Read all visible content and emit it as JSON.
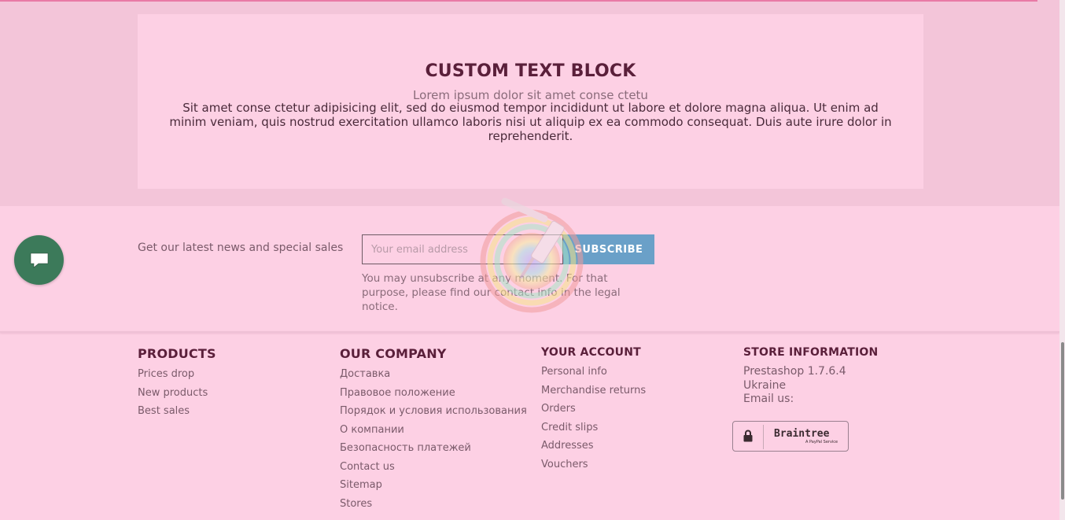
{
  "custom_block": {
    "title": "CUSTOM TEXT BLOCK",
    "subtitle": "Lorem ipsum dolor sit amet conse ctetu",
    "body": "Sit amet conse ctetur adipisicing elit, sed do eiusmod tempor incididunt ut labore et dolore magna aliqua. Ut enim ad minim veniam, quis nostrud exercitation ullamco laboris nisi ut aliquip ex ea commodo consequat. Duis aute irure dolor in reprehenderit."
  },
  "newsletter": {
    "text": "Get our latest news and special sales",
    "email_placeholder": "Your email address",
    "subscribe_label": "SUBSCRIBE",
    "note": "You may unsubscribe at any moment. For that purpose, please find our contact info in the legal notice."
  },
  "footer": {
    "products": {
      "title": "PRODUCTS",
      "items": [
        "Prices drop",
        "New products",
        "Best sales"
      ]
    },
    "company": {
      "title": "OUR COMPANY",
      "items": [
        "Доставка",
        "Правовое положение",
        "Порядок и условия использования",
        "О компании",
        "Безопасность платежей",
        "Contact us",
        "Sitemap",
        "Stores"
      ]
    },
    "account": {
      "title": "YOUR ACCOUNT",
      "items": [
        "Personal info",
        "Merchandise returns",
        "Orders",
        "Credit slips",
        "Addresses",
        "Vouchers"
      ]
    },
    "store": {
      "title": "STORE INFORMATION",
      "lines": [
        "Prestashop 1.7.6.4",
        "Ukraine",
        "Email us:"
      ]
    },
    "braintree": {
      "name": "Braintree",
      "sub": "A PayPal Service"
    }
  },
  "icons": {
    "chat": "chat-icon",
    "lock": "lock-icon",
    "watermark": "paint-roller-logo"
  },
  "colors": {
    "accent": "#6aa0c8",
    "chat_bubble": "#3c7a5a",
    "heading": "#5a1f3a",
    "background": "#fdd0e4"
  }
}
